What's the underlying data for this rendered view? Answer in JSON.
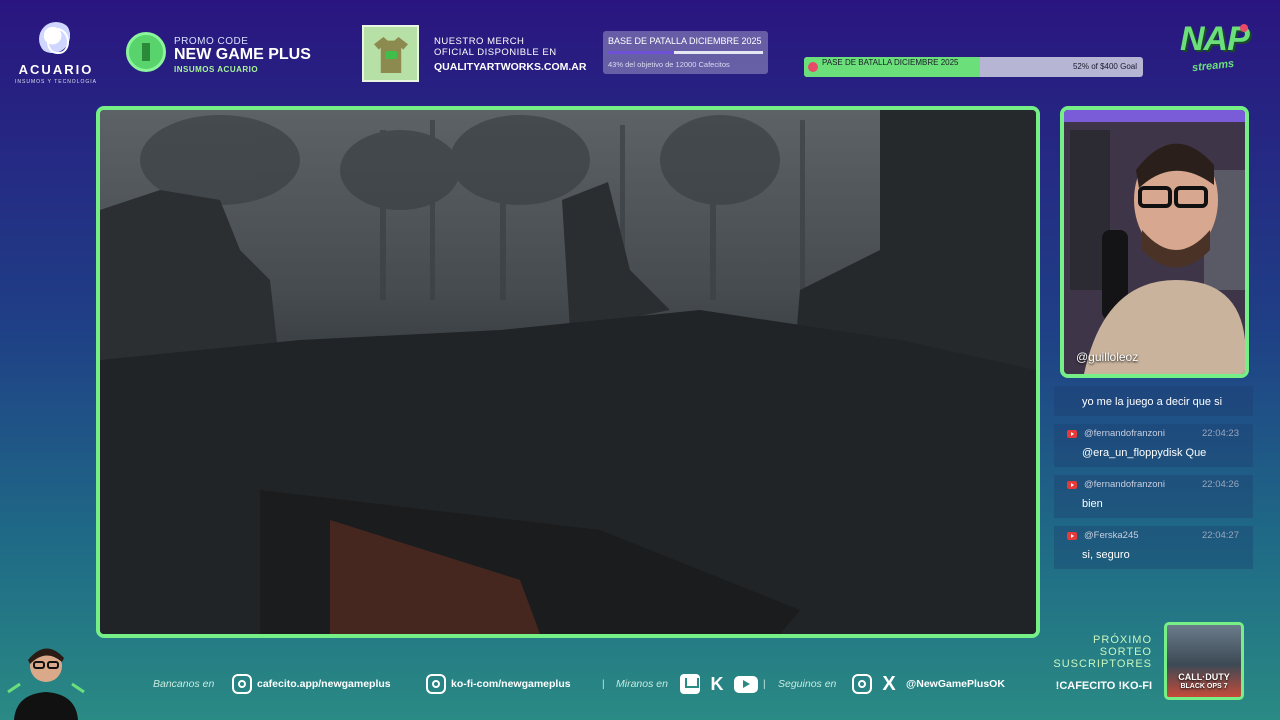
{
  "brand": {
    "name": "ACUARIO",
    "tagline": "INSUMOS Y TECNOLOGIA"
  },
  "promo": {
    "label": "PROMO CODE",
    "code": "NEW GAME PLUS",
    "sponsor": "INSUMOS ACUARIO"
  },
  "merch": {
    "line1": "NUESTRO MERCH",
    "line2": "OFICIAL DISPONIBLE EN",
    "url": "QUALITYARTWORKS.COM.AR"
  },
  "goal_card": {
    "title": "BASE DE PATALLA DICIEMBRE 2025",
    "subtitle": "43% del objetivo de 12000 Cafecitos",
    "progress": 0.43
  },
  "goal_bar": {
    "label": "PASE DE BATALLA DICIEMBRE 2025",
    "status": "52% of $400 Goal",
    "progress": 0.52
  },
  "logo_right": {
    "text": "NAP",
    "sub": "streams"
  },
  "webcam": {
    "handle": "@guilloleoz"
  },
  "chat": {
    "first_message": "yo me la juego a decir que si",
    "messages": [
      {
        "user": "@fernandofranzoni",
        "time": "22:04:23",
        "text": "@era_un_floppydisk Que"
      },
      {
        "user": "@fernandofranzoni",
        "time": "22:04:26",
        "text": "bien"
      },
      {
        "user": "@Ferska245",
        "time": "22:04:27",
        "text": "si, seguro"
      }
    ]
  },
  "bottom": {
    "donate_label": "Bancanos en",
    "cafecito": "cafecito.app/newgameplus",
    "kofi": "ko-fi-com/newgameplus",
    "separator": "|",
    "watch_label": "Miranos en",
    "follow_label": "Seguinos en",
    "social_handle": "@NewGamePlusOK"
  },
  "raffle": {
    "line1": "PRÓXIMO",
    "line2": "SORTEO",
    "line3": "SUSCRIPTORES",
    "commands": "!CAFECITO  !KO-FI"
  },
  "prize": {
    "title": "CALL·DUTY",
    "subtitle": "BLACK OPS 7"
  }
}
